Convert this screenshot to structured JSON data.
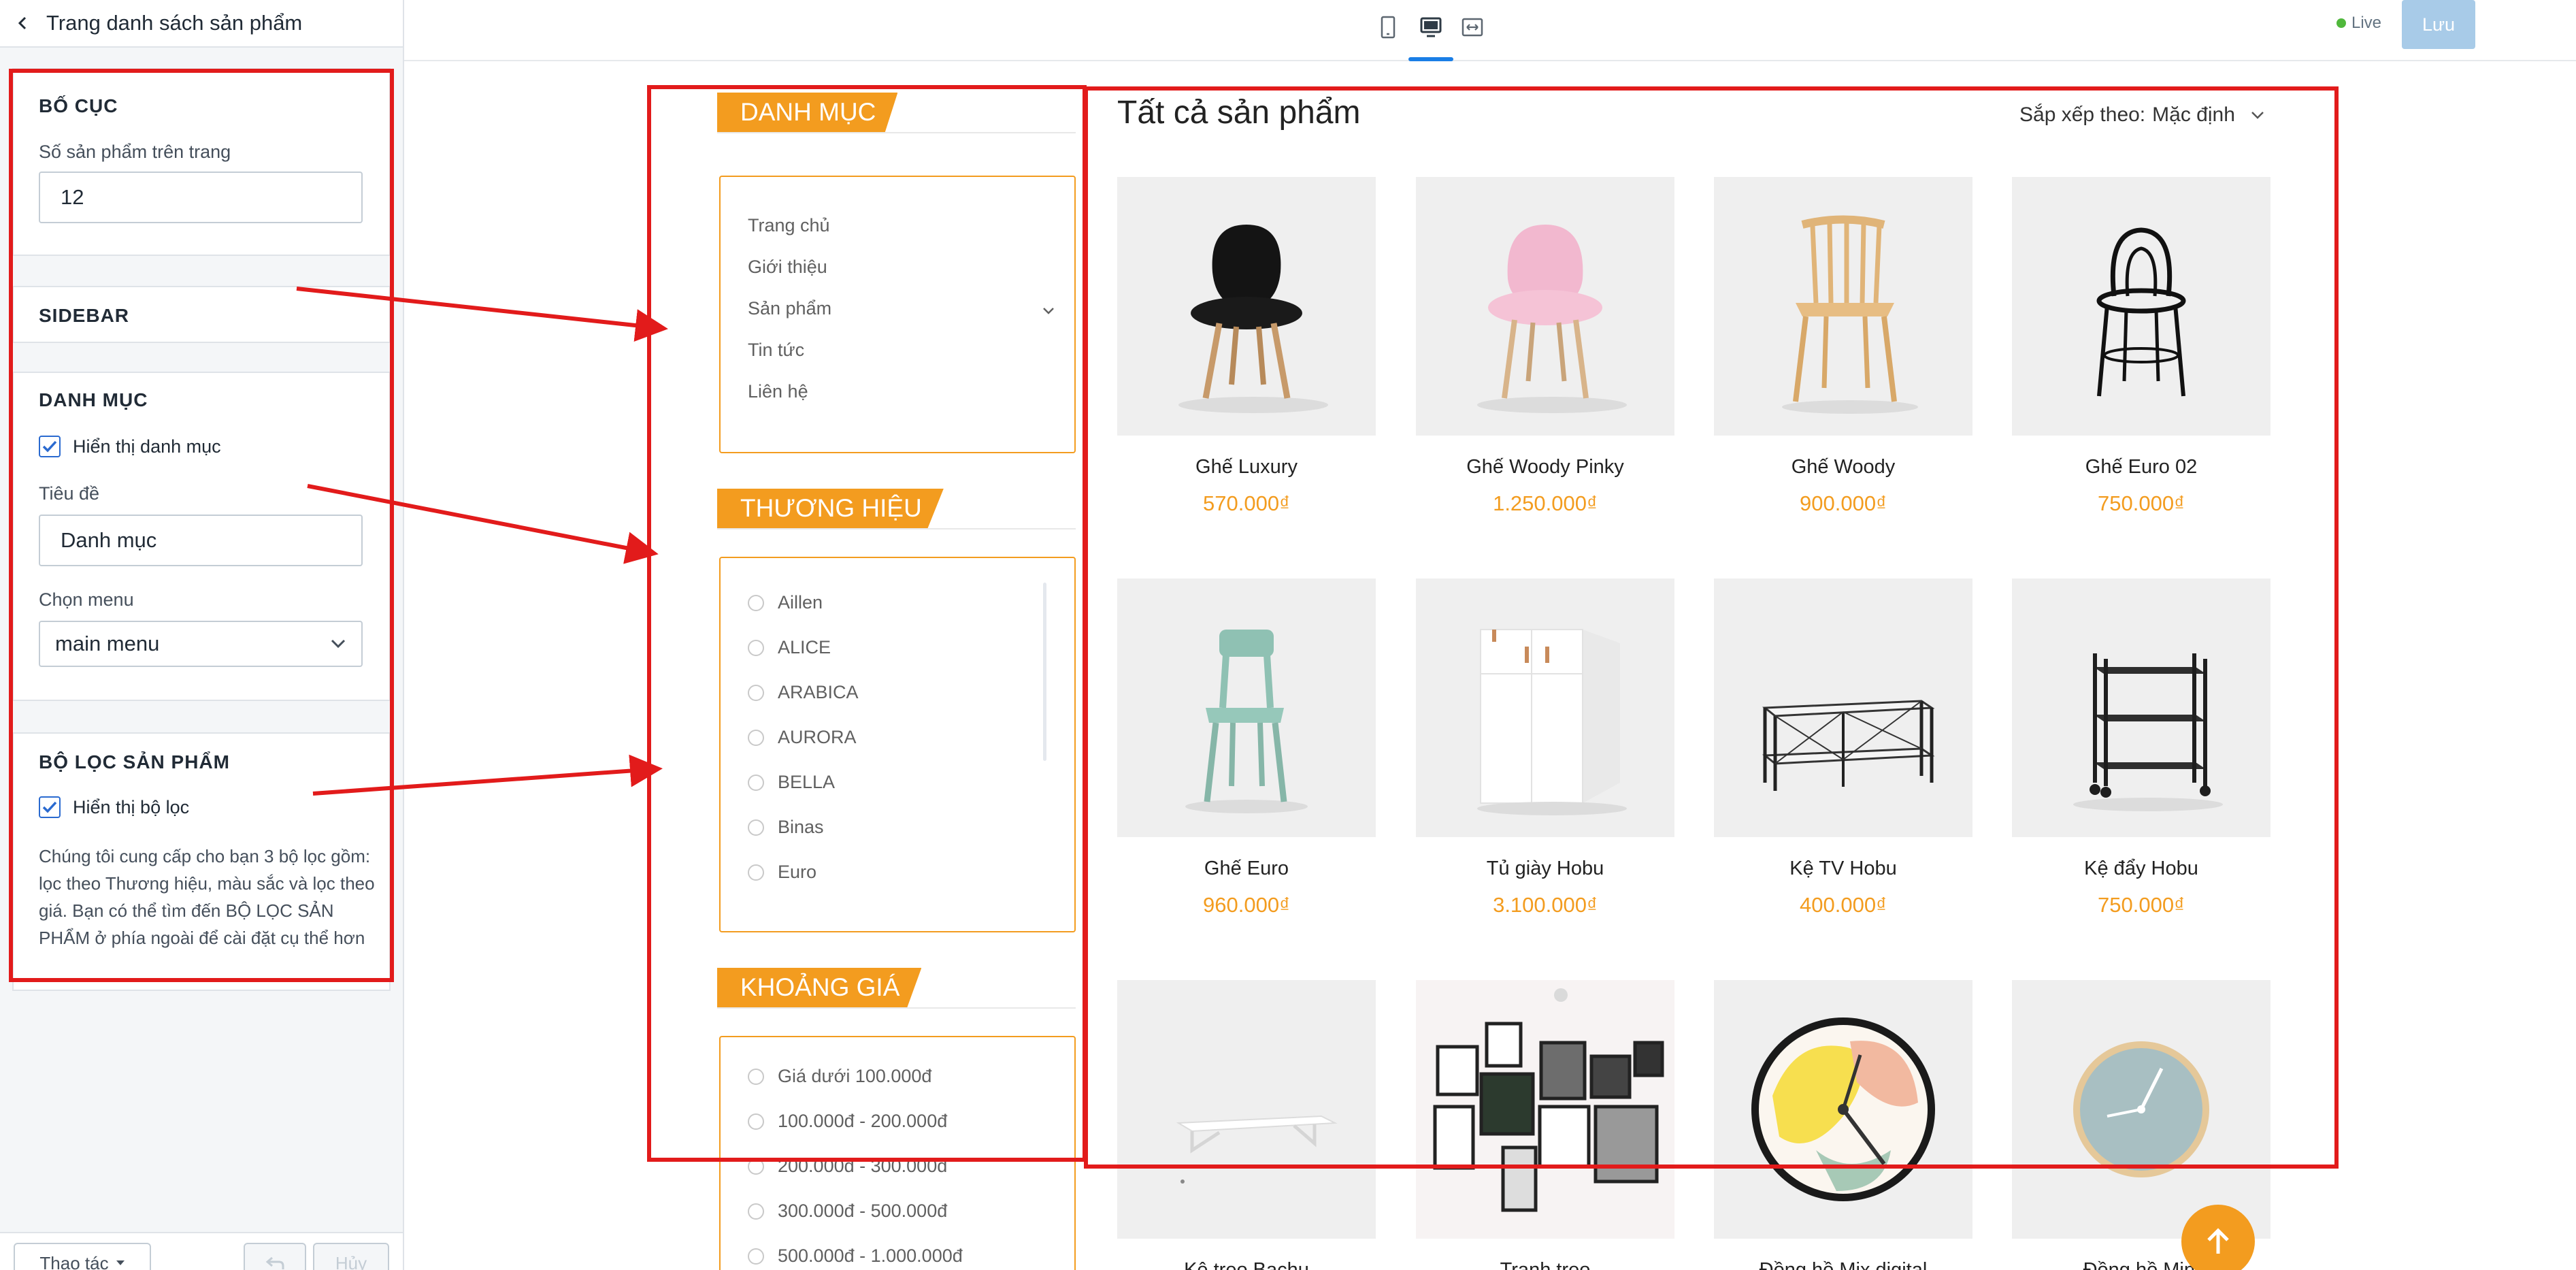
{
  "panel": {
    "title": "Trang danh sách sản phẩm",
    "layout": {
      "heading": "BỐ CỤC",
      "per_page_label": "Số sản phẩm trên trang",
      "per_page_value": "12"
    },
    "sidebar": {
      "heading": "SIDEBAR"
    },
    "category": {
      "heading": "DANH MỤC",
      "show_label": "Hiển thị danh mục",
      "title_label": "Tiêu đề",
      "title_value": "Danh mục",
      "menu_label": "Chọn menu",
      "menu_value": "main menu"
    },
    "filter": {
      "heading": "BỘ LỌC SẢN PHẨM",
      "show_label": "Hiển thị bộ lọc",
      "description": "Chúng tôi cung cấp cho bạn 3 bộ lọc gồm: lọc theo Thương hiệu, màu sắc và lọc theo giá. Bạn có thể tìm đến BỘ LỌC SẢN PHẨM ở phía ngoài để cài đặt cụ thể hơn"
    },
    "footer": {
      "actions_label": "Thao tác",
      "cancel_label": "Hủy"
    }
  },
  "topbar": {
    "live_label": "Live",
    "save_label": "Lưu"
  },
  "preview": {
    "category_heading": "DANH MỤC",
    "menu_items": [
      "Trang chủ",
      "Giới thiệu",
      "Sản phẩm",
      "Tin tức",
      "Liên hệ"
    ],
    "brand_heading": "THƯƠNG HIỆU",
    "brands": [
      "Aillen",
      "ALICE",
      "ARABICA",
      "AURORA",
      "BELLA",
      "Binas",
      "Euro"
    ],
    "price_heading": "KHOẢNG GIÁ",
    "price_ranges": [
      "Giá dưới 100.000đ",
      "100.000đ - 200.000đ",
      "200.000đ - 300.000đ",
      "300.000đ - 500.000đ",
      "500.000đ - 1.000.000đ"
    ],
    "products_title": "Tất cả sản phẩm",
    "sort_label": "Sắp xếp theo:",
    "sort_value": "Mặc định",
    "products": [
      {
        "name": "Ghế Luxury",
        "price": "570.000₫"
      },
      {
        "name": "Ghế Woody Pinky",
        "price": "1.250.000₫"
      },
      {
        "name": "Ghế Woody",
        "price": "900.000₫"
      },
      {
        "name": "Ghế Euro 02",
        "price": "750.000₫"
      },
      {
        "name": "Ghế Euro",
        "price": "960.000₫"
      },
      {
        "name": "Tủ giày Hobu",
        "price": "3.100.000₫"
      },
      {
        "name": "Kệ TV Hobu",
        "price": "400.000₫"
      },
      {
        "name": "Kệ đẩy Hobu",
        "price": "750.000₫"
      },
      {
        "name": "Kệ treo Bachu",
        "price": ""
      },
      {
        "name": "Tranh treo",
        "price": ""
      },
      {
        "name": "Đồng hồ Mix digital",
        "price": ""
      },
      {
        "name": "Đồng hồ Mini",
        "price": ""
      }
    ]
  },
  "colors": {
    "accent": "#f39c1f",
    "annotation": "#e21b1b",
    "primary": "#2a6ad0",
    "live": "#50b83c"
  },
  "icons": {
    "back": "chevron-left-icon",
    "devices": [
      "mobile-icon",
      "desktop-icon",
      "fullscreen-icon"
    ],
    "sort": "chevron-down-icon",
    "scroll_top": "arrow-up-icon"
  }
}
